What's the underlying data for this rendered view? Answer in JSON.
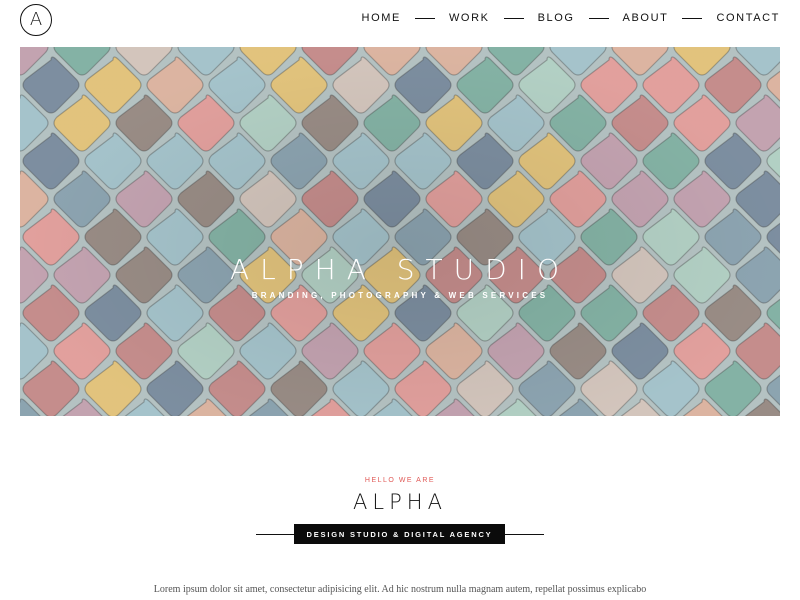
{
  "brand": {
    "logo_letter": "A"
  },
  "nav": {
    "items": [
      {
        "label": "HOME"
      },
      {
        "label": "WORK"
      },
      {
        "label": "BLOG"
      },
      {
        "label": "ABOUT"
      },
      {
        "label": "CONTACT"
      }
    ]
  },
  "hero": {
    "title": "ALPHA STUDIO",
    "subtitle": "BRANDING, PHOTOGRAPHY & WEB SERVICES",
    "image_palette": [
      "#c9908f",
      "#87b6a8",
      "#e6c77f",
      "#7f91a3",
      "#e6a3a0",
      "#a8c7cf",
      "#d7c9c0",
      "#9c8f88",
      "#c7a6b4",
      "#b6d4c8",
      "#8fa7b4",
      "#e0b8a4"
    ]
  },
  "intro": {
    "eyebrow": "HELLO WE ARE",
    "title": "ALPHA",
    "tagline": "DESIGN STUDIO & DIGITAL AGENCY",
    "body": "Lorem ipsum dolor sit amet, consectetur adipisicing elit. Ad hic nostrum nulla magnam autem, repellat possimus explicabo"
  },
  "colors": {
    "accent": "#e05a57",
    "text": "#111111",
    "badge_bg": "#0b0b0b"
  }
}
